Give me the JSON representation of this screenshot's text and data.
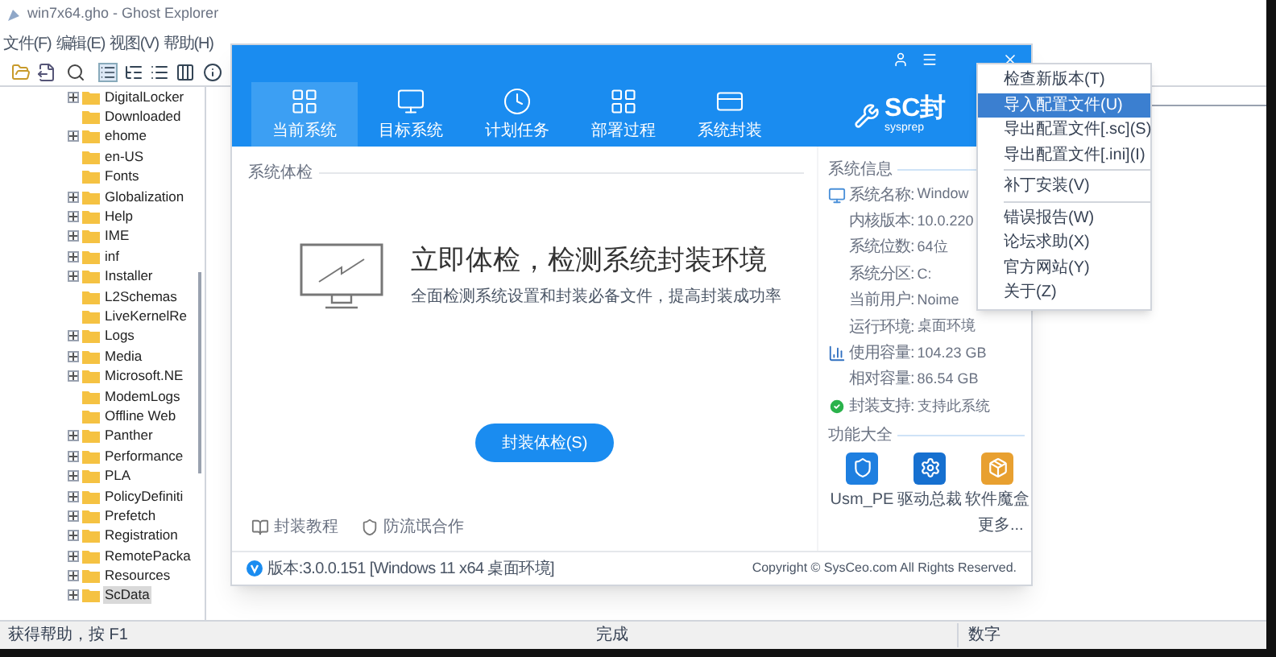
{
  "explorer": {
    "title": "win7x64.gho - Ghost Explorer",
    "menu": [
      "文件(F)",
      "编辑(E)",
      "视图(V)",
      "帮助(H)"
    ],
    "tree": [
      {
        "label": "DigitalLocker",
        "expandable": true,
        "selected": false
      },
      {
        "label": "Downloaded",
        "expandable": false,
        "selected": false
      },
      {
        "label": "ehome",
        "expandable": true,
        "selected": false
      },
      {
        "label": "en-US",
        "expandable": false,
        "selected": false
      },
      {
        "label": "Fonts",
        "expandable": false,
        "selected": false
      },
      {
        "label": "Globalization",
        "expandable": true,
        "selected": false
      },
      {
        "label": "Help",
        "expandable": true,
        "selected": false
      },
      {
        "label": "IME",
        "expandable": true,
        "selected": false
      },
      {
        "label": "inf",
        "expandable": true,
        "selected": false
      },
      {
        "label": "Installer",
        "expandable": true,
        "selected": false
      },
      {
        "label": "L2Schemas",
        "expandable": false,
        "selected": false
      },
      {
        "label": "LiveKernelRe",
        "expandable": false,
        "selected": false
      },
      {
        "label": "Logs",
        "expandable": true,
        "selected": false
      },
      {
        "label": "Media",
        "expandable": true,
        "selected": false
      },
      {
        "label": "Microsoft.NE",
        "expandable": true,
        "selected": false
      },
      {
        "label": "ModemLogs",
        "expandable": false,
        "selected": false
      },
      {
        "label": "Offline Web",
        "expandable": false,
        "selected": false
      },
      {
        "label": "Panther",
        "expandable": true,
        "selected": false
      },
      {
        "label": "Performance",
        "expandable": true,
        "selected": false
      },
      {
        "label": "PLA",
        "expandable": true,
        "selected": false
      },
      {
        "label": "PolicyDefiniti",
        "expandable": true,
        "selected": false
      },
      {
        "label": "Prefetch",
        "expandable": true,
        "selected": false
      },
      {
        "label": "Registration",
        "expandable": true,
        "selected": false
      },
      {
        "label": "RemotePacka",
        "expandable": true,
        "selected": false
      },
      {
        "label": "Resources",
        "expandable": true,
        "selected": false
      },
      {
        "label": "ScData",
        "expandable": true,
        "selected": true
      }
    ],
    "status_bar": [
      "获得帮助，按 F1",
      "完成",
      "数字"
    ]
  },
  "sc_window": {
    "tabs": [
      {
        "label": "当前系统",
        "selected": true
      },
      {
        "label": "目标系统",
        "selected": false
      },
      {
        "label": "计划任务",
        "selected": false
      },
      {
        "label": "部署过程",
        "selected": false
      },
      {
        "label": "系统封装",
        "selected": false
      }
    ],
    "logo": {
      "text": "SC封",
      "subtitle": "sysprep"
    },
    "check": {
      "heading": "系统体检",
      "title": "立即体检，检测系统封装环境",
      "subtitle": "全面检测系统设置和封装必备文件，提高封装成功率",
      "button": "封装体检(S)",
      "links": [
        "封装教程",
        "防流氓合作"
      ]
    },
    "info": {
      "heading": "系统信息",
      "rows": [
        {
          "kind": "monitor",
          "label": "系统名称:",
          "value": "Window"
        },
        {
          "kind": "plain",
          "label": "内核版本:",
          "value": "10.0.220"
        },
        {
          "kind": "plain",
          "label": "系统位数:",
          "value": "64位"
        },
        {
          "kind": "plain",
          "label": "系统分区:",
          "value": "C:"
        },
        {
          "kind": "plain",
          "label": "当前用户:",
          "value": "Noime"
        },
        {
          "kind": "plain",
          "label": "运行环境:",
          "value": "桌面环境"
        },
        {
          "kind": "chart",
          "label": "使用容量:",
          "value": "104.23 GB"
        },
        {
          "kind": "plain",
          "label": "相对容量:",
          "value": "86.54 GB"
        },
        {
          "kind": "check",
          "label": "封装支持:",
          "value": "支持此系统"
        }
      ]
    },
    "tools": {
      "heading": "功能大全",
      "items": [
        "Usm_PE",
        "驱动总裁",
        "软件魔盒"
      ],
      "more": "更多..."
    },
    "footer": {
      "version": "版本:3.0.0.151 [Windows 11 x64 桌面环境]",
      "copyright": "Copyright © SysCeo.com All Rights Reserved."
    }
  },
  "menu": {
    "items": [
      {
        "kind": "item",
        "label": "检查新版本(T)",
        "selected": false
      },
      {
        "kind": "item",
        "label": "导入配置文件(U)",
        "selected": true
      },
      {
        "kind": "item",
        "label": "导出配置文件[.sc](S)",
        "selected": false
      },
      {
        "kind": "item",
        "label": "导出配置文件[.ini](I)",
        "selected": false
      },
      {
        "kind": "separator"
      },
      {
        "kind": "item",
        "label": "补丁安装(V)",
        "selected": false
      },
      {
        "kind": "separator"
      },
      {
        "kind": "item",
        "label": "错误报告(W)",
        "selected": false
      },
      {
        "kind": "item",
        "label": "论坛求助(X)",
        "selected": false
      },
      {
        "kind": "item",
        "label": "官方网站(Y)",
        "selected": false
      },
      {
        "kind": "item",
        "label": "关于(Z)",
        "selected": false
      }
    ]
  }
}
